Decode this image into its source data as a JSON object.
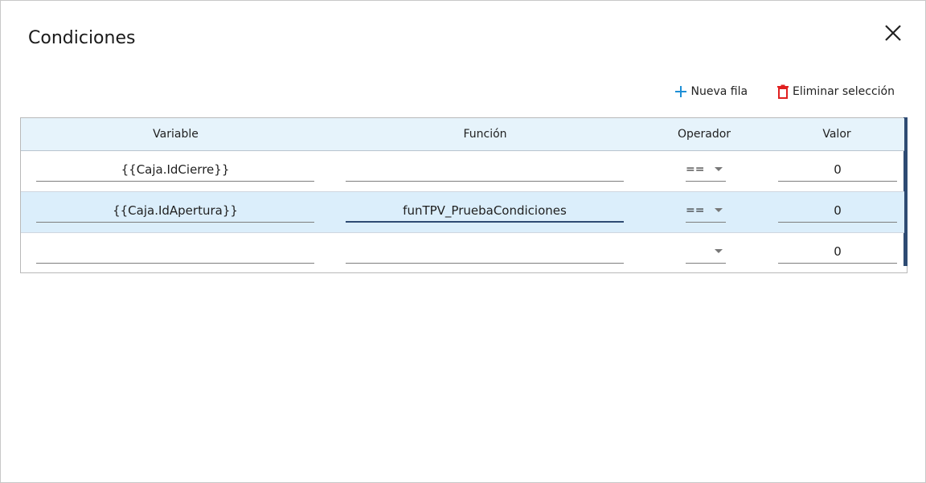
{
  "dialog": {
    "title": "Condiciones"
  },
  "toolbar": {
    "add_row_label": "Nueva fila",
    "delete_selection_label": "Eliminar selección"
  },
  "colors": {
    "accent": "#2e4b73",
    "add_icon": "#1e8fd6",
    "delete_icon": "#e02020",
    "header_bg": "#e6f3fb",
    "selected_row_bg": "#dbeefb"
  },
  "grid": {
    "columns": [
      "Variable",
      "Función",
      "Operador",
      "Valor"
    ],
    "rows": [
      {
        "variable": "{{Caja.IdCierre}}",
        "funcion": "",
        "operador": "==",
        "valor": "0"
      },
      {
        "variable": "{{Caja.IdApertura}}",
        "funcion": "funTPV_PruebaCondiciones",
        "operador": "==",
        "valor": "0"
      },
      {
        "variable": "",
        "funcion": "",
        "operador": "",
        "valor": "0"
      }
    ]
  },
  "icons": {
    "close": "close-icon",
    "add": "plus-icon",
    "delete": "trash-icon",
    "dropdown": "chevron-down-icon"
  }
}
